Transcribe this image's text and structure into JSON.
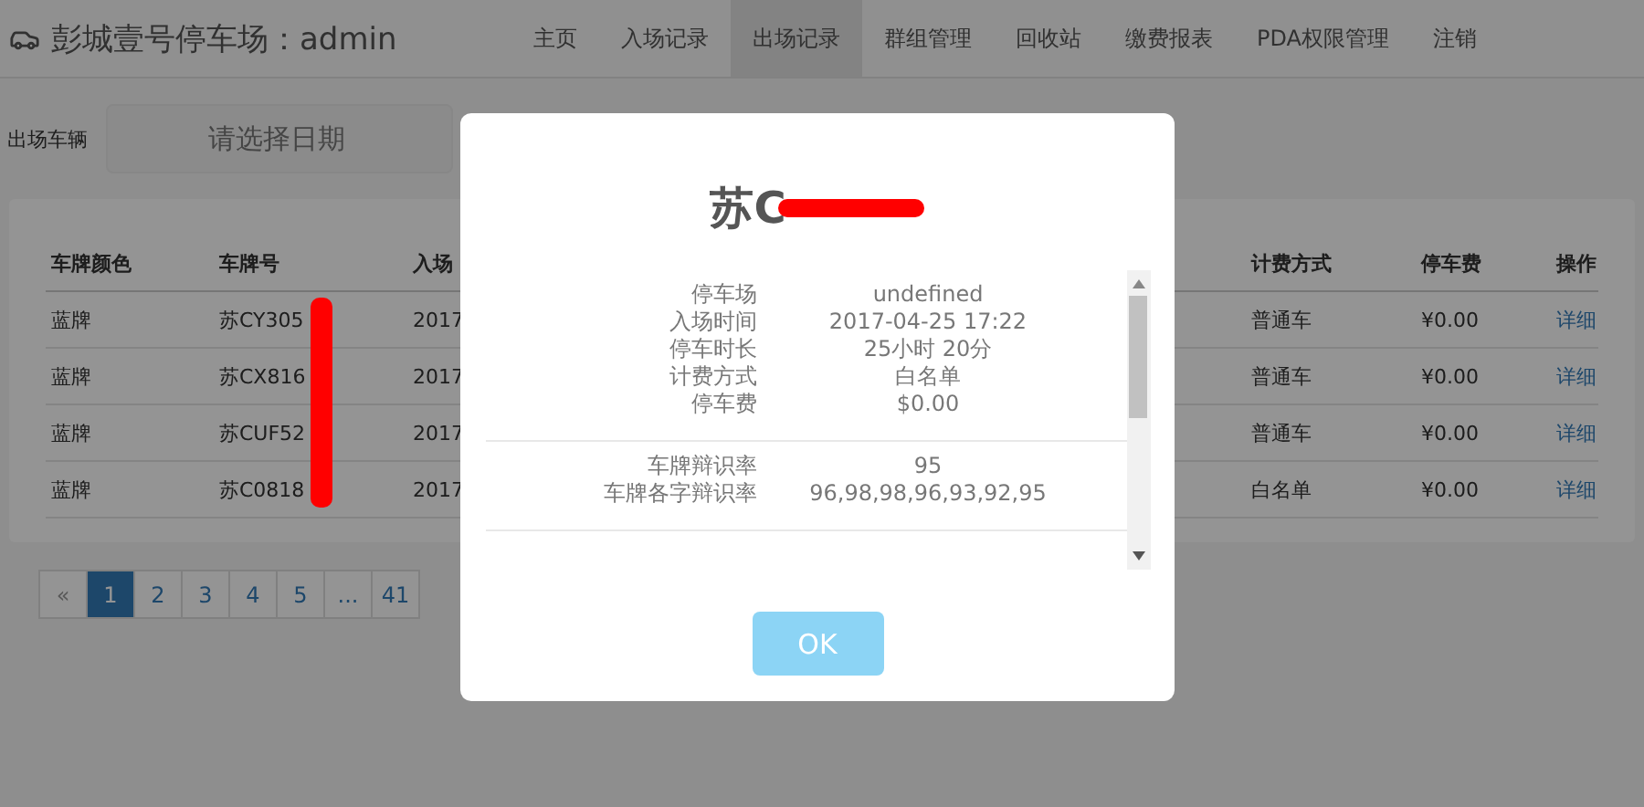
{
  "header": {
    "title": "彭城壹号停车场：admin",
    "nav": [
      {
        "label": "主页",
        "selected": false
      },
      {
        "label": "入场记录",
        "selected": false
      },
      {
        "label": "出场记录",
        "selected": true
      },
      {
        "label": "群组管理",
        "selected": false
      },
      {
        "label": "回收站",
        "selected": false
      },
      {
        "label": "缴费报表",
        "selected": false
      },
      {
        "label": "PDA权限管理",
        "selected": false
      },
      {
        "label": "注销",
        "selected": false
      }
    ]
  },
  "filter": {
    "label": "出场车辆",
    "placeholder": "请选择日期"
  },
  "table": {
    "columns": [
      "车牌颜色",
      "车牌号",
      "入场",
      "计费方式",
      "停车费",
      "操作"
    ],
    "rows": [
      {
        "plate_color": "蓝牌",
        "plate": "苏CY305",
        "entry": "2017",
        "billing": "普通车",
        "fee": "¥0.00",
        "action": "详细"
      },
      {
        "plate_color": "蓝牌",
        "plate": "苏CX816",
        "entry": "2017",
        "billing": "普通车",
        "fee": "¥0.00",
        "action": "详细"
      },
      {
        "plate_color": "蓝牌",
        "plate": "苏CUF52",
        "entry": "2017",
        "billing": "普通车",
        "fee": "¥0.00",
        "action": "详细"
      },
      {
        "plate_color": "蓝牌",
        "plate": "苏C0818",
        "entry": "2017",
        "billing": "白名单",
        "fee": "¥0.00",
        "action": "详细"
      }
    ]
  },
  "pagination": {
    "prev": "«",
    "pages": [
      {
        "label": "1",
        "selected": true
      },
      {
        "label": "2",
        "selected": false
      },
      {
        "label": "3",
        "selected": false
      },
      {
        "label": "4",
        "selected": false
      },
      {
        "label": "5",
        "selected": false
      },
      {
        "label": "...",
        "selected": false
      },
      {
        "label": "41",
        "selected": false
      }
    ]
  },
  "dialog": {
    "title": "苏C",
    "sections": [
      [
        {
          "label": "停车场",
          "value": "undefined"
        },
        {
          "label": "入场时间",
          "value": "2017-04-25 17:22"
        },
        {
          "label": "停车时长",
          "value": "25小时 20分"
        },
        {
          "label": "计费方式",
          "value": "白名单"
        },
        {
          "label": "停车费",
          "value": "$0.00"
        }
      ],
      [
        {
          "label": "车牌辩识率",
          "value": "95"
        },
        {
          "label": "车牌各字辩识率",
          "value": "96,98,98,96,93,92,95"
        }
      ]
    ],
    "button": "OK"
  }
}
